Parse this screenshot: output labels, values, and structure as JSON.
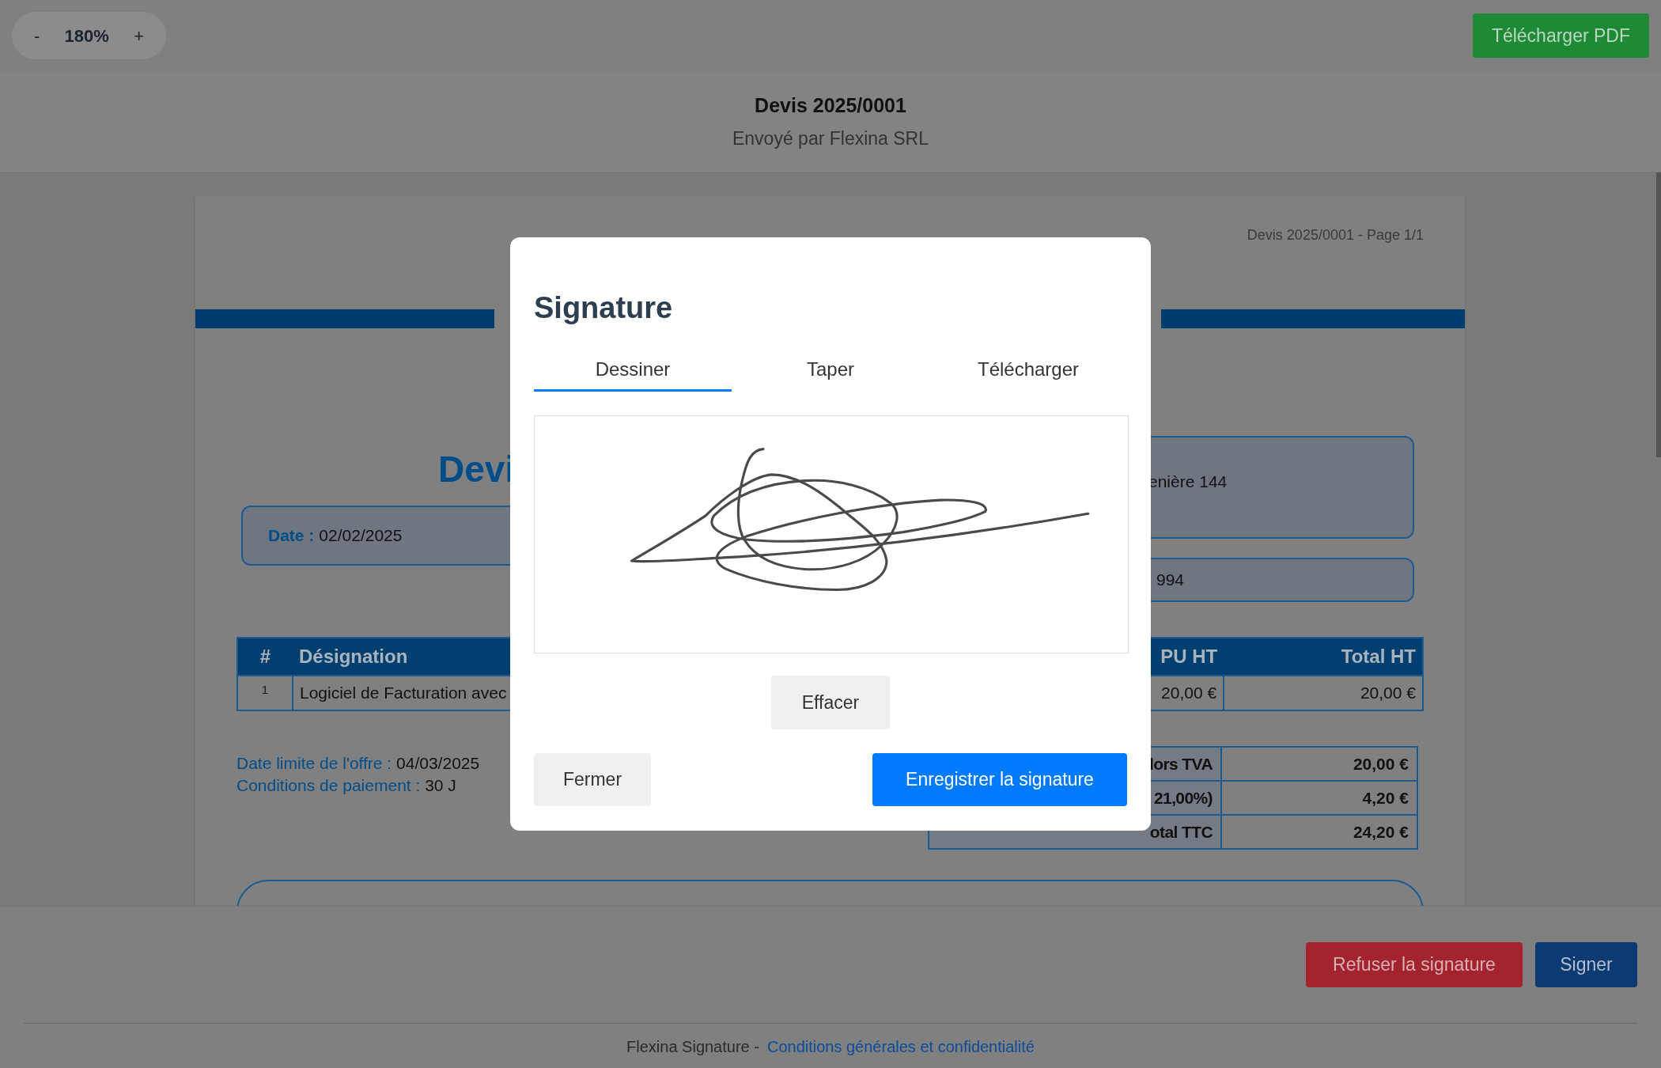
{
  "toolbar": {
    "zoom_out": "-",
    "zoom": "180%",
    "zoom_in": "+",
    "download": "Télécharger PDF"
  },
  "header": {
    "title": "Devis 2025/0001",
    "subtitle": "Envoyé par Flexina SRL"
  },
  "document": {
    "page_label": "Devis 2025/0001 - Page 1/1",
    "title": "Devi",
    "date_label": "Date :",
    "date": "02/02/2025",
    "address_fragment": "enière 144",
    "number_fragment": "994",
    "table": {
      "columns": [
        "#",
        "Désignation",
        "PU HT",
        "Total HT"
      ],
      "rows": [
        [
          "1",
          "Logiciel de Facturation avec",
          "20,00 €",
          "20,00 €"
        ]
      ]
    },
    "terms": [
      {
        "label": "Date limite de l'offre :",
        "value": "04/03/2025"
      },
      {
        "label": "Conditions de paiement :",
        "value": "30 J"
      }
    ],
    "totals": [
      {
        "label": "lors TVA",
        "value": "20,00 €"
      },
      {
        "label": "21,00%)",
        "value": "4,20 €"
      },
      {
        "label": "otal TTC",
        "value": "24,20 €"
      }
    ]
  },
  "dialog": {
    "title": "Signature",
    "tabs": [
      {
        "label": "Dessiner",
        "selected": true
      },
      {
        "label": "Taper",
        "selected": false
      },
      {
        "label": "Télécharger",
        "selected": false
      }
    ],
    "clear": "Effacer",
    "close": "Fermer",
    "save": "Enregistrer la signature"
  },
  "actions": {
    "refuse": "Refuser la signature",
    "sign": "Signer"
  },
  "footer": {
    "brand": "Flexina Signature -",
    "link": "Conditions générales et confidentialité"
  }
}
